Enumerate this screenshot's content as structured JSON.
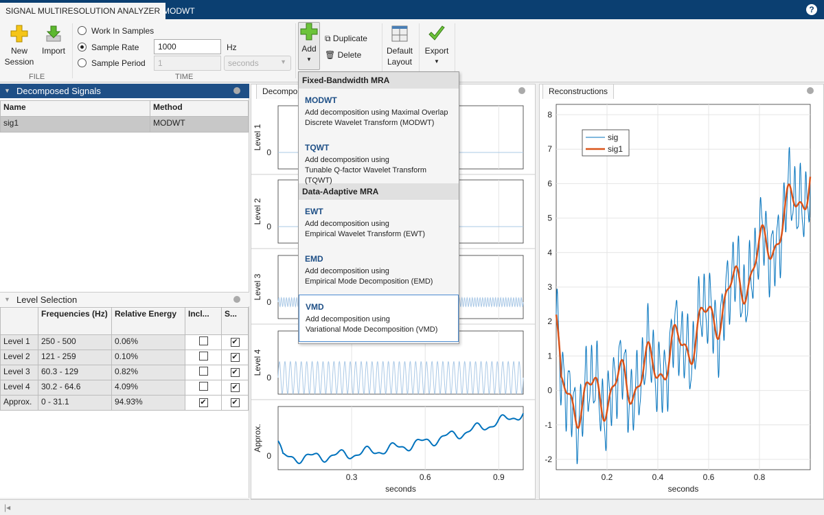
{
  "tabs": [
    "SIGNAL MULTIRESOLUTION ANALYZER",
    "MODWT"
  ],
  "help_label": "?",
  "toolbar": {
    "new_session": "New\nSession",
    "import": "Import",
    "file_section": "FILE",
    "work_in_samples": "Work In Samples",
    "sample_rate": "Sample Rate",
    "sample_rate_value": "1000",
    "hz": "Hz",
    "sample_period": "Sample Period",
    "sample_period_value": "1",
    "period_unit": "seconds",
    "time_section": "TIME",
    "add": "Add",
    "duplicate": "Duplicate",
    "delete": "Delete",
    "default_layout": "Default\nLayout",
    "export": "Export"
  },
  "decomposed": {
    "title": "Decomposed Signals",
    "columns": [
      "Name",
      "Method"
    ],
    "rows": [
      [
        "sig1",
        "MODWT"
      ]
    ]
  },
  "level_selection": {
    "title": "Level Selection",
    "columns": [
      "",
      "Frequencies (Hz)",
      "Relative Energy",
      "Incl...",
      "S..."
    ],
    "rows": [
      {
        "level": "Level 1",
        "freq": "250 - 500",
        "energy": "0.06%",
        "include": false,
        "show": true
      },
      {
        "level": "Level 2",
        "freq": "121 - 259",
        "energy": "0.10%",
        "include": false,
        "show": true
      },
      {
        "level": "Level 3",
        "freq": "60.3 - 129",
        "energy": "0.82%",
        "include": false,
        "show": true
      },
      {
        "level": "Level 4",
        "freq": "30.2 - 64.6",
        "energy": "4.09%",
        "include": false,
        "show": true
      },
      {
        "level": "Approx.",
        "freq": "0 - 31.1",
        "energy": "94.93%",
        "include": true,
        "show": true
      }
    ]
  },
  "menu": {
    "groups": [
      {
        "title": "Fixed-Bandwidth MRA",
        "items": [
          {
            "name": "MODWT",
            "desc1": "Add decomposition using Maximal Overlap",
            "desc2": "Discrete Wavelet Transform (MODWT)"
          },
          {
            "name": "TQWT",
            "desc1": "Add decomposition using",
            "desc2": "Tunable Q-factor Wavelet Transform (TQWT)"
          }
        ]
      },
      {
        "title": "Data-Adaptive MRA",
        "items": [
          {
            "name": "EWT",
            "desc1": "Add decomposition using",
            "desc2": "Empirical Wavelet Transform (EWT)"
          },
          {
            "name": "EMD",
            "desc1": "Add decomposition using",
            "desc2": "Empirical Mode Decomposition (EMD)"
          },
          {
            "name": "VMD",
            "desc1": "Add decomposition using",
            "desc2": "Variational Mode Decomposition (VMD)"
          }
        ]
      }
    ]
  },
  "decomp_panel": {
    "tab": "Decompo",
    "levels": [
      "Level 1",
      "Level 2",
      "Level 3",
      "Level 4",
      "Approx."
    ],
    "zero": "0",
    "xticks": [
      "0.3",
      "0.6",
      "0.9"
    ],
    "xlabel": "seconds"
  },
  "recon_panel": {
    "tab": "Reconstructions",
    "legend": [
      "sig",
      "sig1"
    ],
    "yticks": [
      "-2",
      "-1",
      "0",
      "1",
      "2",
      "3",
      "4",
      "5",
      "6",
      "7",
      "8"
    ],
    "xticks": [
      "0.2",
      "0.4",
      "0.6",
      "0.8"
    ],
    "xlabel": "seconds",
    "colors": {
      "sig": "#0072bd",
      "sig1": "#d95319"
    }
  }
}
